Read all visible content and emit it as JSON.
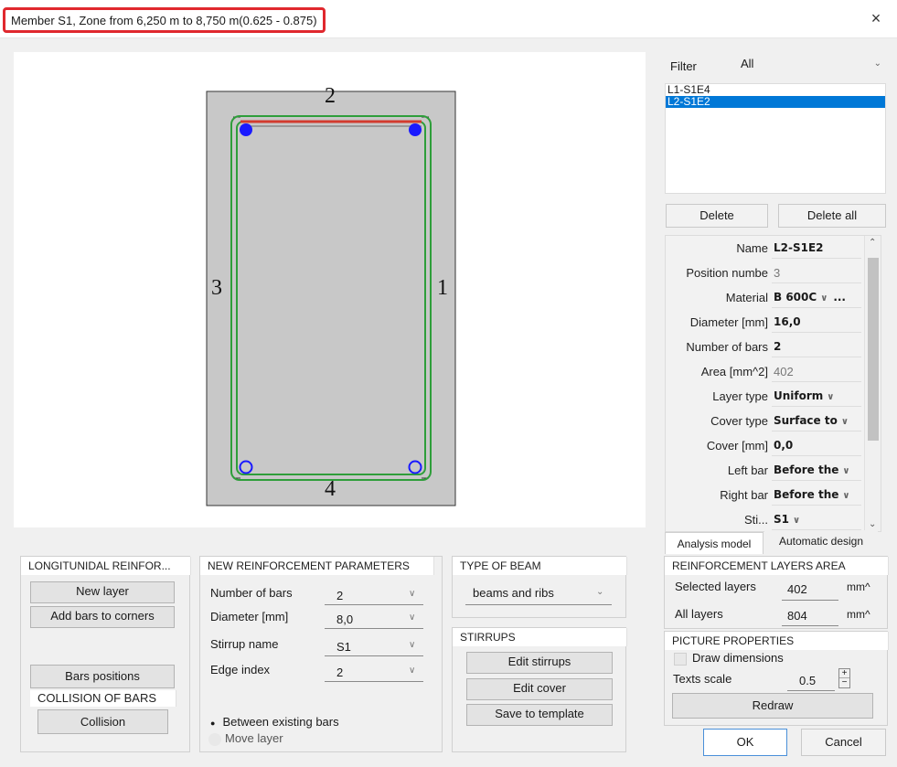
{
  "window": {
    "title": "Member S1, Zone from 6,250 m to 8,750 m(0.625 - 0.875)",
    "close_glyph": "×"
  },
  "drawing": {
    "edge_labels": [
      "2",
      "3",
      "1",
      "4"
    ],
    "colors": {
      "section_fill": "#c8c8c8",
      "stirrup": "#2e9e3a",
      "top_layer": "#d23b2f",
      "bars_selected": "#1a1aff"
    }
  },
  "filter": {
    "label": "Filter",
    "value": "All",
    "layers": [
      "L1-S1E4",
      "L2-S1E2"
    ],
    "selected_index": 1,
    "delete_label": "Delete",
    "delete_all_label": "Delete all"
  },
  "properties": [
    {
      "name": "Name",
      "value": "L2-S1E2",
      "style": "bold"
    },
    {
      "name": "Position numbe",
      "value": "3",
      "style": "grey"
    },
    {
      "name": "Material",
      "value": "B 600C",
      "style": "bold",
      "dropdown": true,
      "extra": "..."
    },
    {
      "name": "Diameter [mm]",
      "value": "16,0",
      "style": "bold"
    },
    {
      "name": "Number of bars",
      "value": "2",
      "style": "bold"
    },
    {
      "name": "Area [mm^2]",
      "value": "402",
      "style": "grey"
    },
    {
      "name": "Layer type",
      "value": "Uniform",
      "style": "bold",
      "dropdown": true
    },
    {
      "name": "Cover type",
      "value": "Surface to",
      "style": "bold",
      "dropdown": true
    },
    {
      "name": "Cover [mm]",
      "value": "0,0",
      "style": "bold"
    },
    {
      "name": "Left bar",
      "value": "Before the",
      "style": "bold",
      "dropdown": true
    },
    {
      "name": "Right bar",
      "value": "Before the",
      "style": "bold",
      "dropdown": true
    },
    {
      "name": "Sti...",
      "value": "S1",
      "style": "bold",
      "dropdown": true
    }
  ],
  "tabs": {
    "analysis": "Analysis model",
    "automatic": "Automatic design"
  },
  "longitudinal": {
    "header": "LONGITUNIDAL REINFOR...",
    "new_layer": "New layer",
    "add_bars": "Add bars to corners",
    "bars_positions": "Bars positions",
    "collision_header": "COLLISION OF BARS",
    "collision": "Collision"
  },
  "new_params": {
    "header": "NEW REINFORCEMENT PARAMETERS",
    "rows": [
      {
        "label": "Number of bars",
        "value": "2"
      },
      {
        "label": "Diameter [mm]",
        "value": "8,0"
      },
      {
        "label": "Stirrup name",
        "value": "S1"
      },
      {
        "label": "Edge index",
        "value": "2"
      }
    ],
    "radio_between": "Between existing bars",
    "radio_move": "Move layer"
  },
  "beam": {
    "header": "TYPE OF BEAM",
    "value": "beams and ribs"
  },
  "stirrups": {
    "header": "STIRRUPS",
    "edit_stirrups": "Edit stirrups",
    "edit_cover": "Edit cover",
    "save_template": "Save to template"
  },
  "layers_area": {
    "header": "REINFORCEMENT LAYERS AREA",
    "selected_label": "Selected layers",
    "selected_value": "402",
    "all_label": "All layers",
    "all_value": "804",
    "unit": "mm^"
  },
  "picture": {
    "header": "PICTURE PROPERTIES",
    "draw_dimensions": "Draw dimensions",
    "texts_scale_label": "Texts scale",
    "texts_scale_value": "0.5",
    "redraw": "Redraw"
  },
  "footer": {
    "ok": "OK",
    "cancel": "Cancel"
  }
}
